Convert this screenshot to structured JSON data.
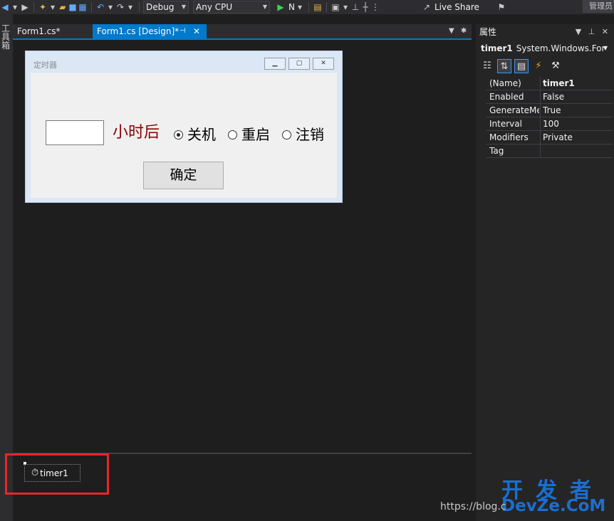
{
  "toolbar": {
    "config": "Debug",
    "platform": "Any CPU",
    "run_label": "N",
    "live_share": "Live Share",
    "manage": "管理员"
  },
  "toolbox": {
    "label": "工具箱"
  },
  "tabs": [
    {
      "label": "Form1.cs*"
    },
    {
      "label": "Form1.cs [Design]*"
    }
  ],
  "form": {
    "title": "定时器",
    "hours_input_value": "",
    "hours_label": "小时后",
    "radios": [
      {
        "label": "关机",
        "checked": true
      },
      {
        "label": "重启",
        "checked": false
      },
      {
        "label": "注销",
        "checked": false
      }
    ],
    "ok_label": "确定"
  },
  "tray": {
    "component_label": "timer1"
  },
  "properties": {
    "header": "属性",
    "object_name": "timer1",
    "object_type": "System.Windows.For",
    "rows": [
      {
        "name": "(Name)",
        "value": "timer1"
      },
      {
        "name": "Enabled",
        "value": "False"
      },
      {
        "name": "GenerateMe",
        "value": "True"
      },
      {
        "name": "Interval",
        "value": "100"
      },
      {
        "name": "Modifiers",
        "value": "Private"
      },
      {
        "name": "Tag",
        "value": ""
      }
    ]
  },
  "watermark": {
    "url": "https://blog.c",
    "title": "开发者",
    "subtitle": "DevZe.CoM"
  },
  "colors": {
    "accent": "#007acc",
    "highlight_box": "#e8262b",
    "form_label": "#8b0000"
  }
}
